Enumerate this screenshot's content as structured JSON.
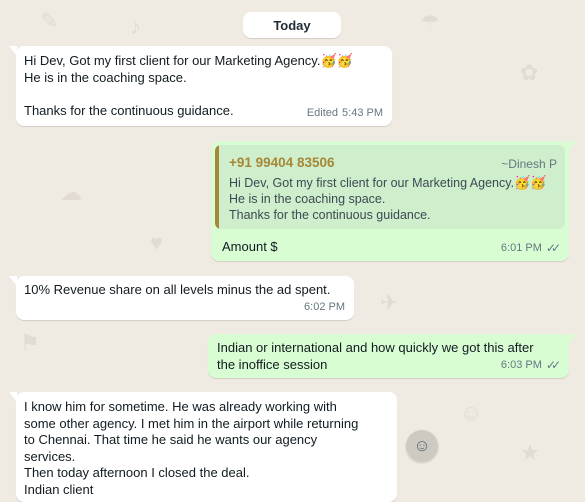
{
  "date_pill": "Today",
  "messages": [
    {
      "line1": "Hi Dev, Got my first client for our Marketing Agency.",
      "emoji": "🥳🥳",
      "rest": "He is in the coaching space.\n\nThanks for the continuous guidance.",
      "edited": "Edited",
      "time": "5:43 PM"
    },
    {
      "quote_sender": "+91 99404 83506",
      "quote_name": "~Dinesh P",
      "quote_line1": "Hi Dev, Got my first client for our Marketing Agency.",
      "quote_emoji": "🥳🥳",
      "quote_rest": "He is in the coaching space.\nThanks for the continuous guidance.",
      "text": "Amount $",
      "time": "6:01 PM"
    },
    {
      "text": "10% Revenue share on all levels minus the ad spent.",
      "time": "6:02 PM"
    },
    {
      "text": "Indian or international and how quickly we got this after\nthe inoffice session",
      "time": "6:03 PM"
    },
    {
      "text": "I know him for sometime. He was already working with\nsome other agency. I met him in the airport while returning\nto Chennai. That time he said he wants our agency\nservices.\nThen today afternoon I closed the deal.\nIndian client"
    }
  ],
  "icons": {
    "read_receipt": "double-check-icon",
    "emoji_button": "emoji-icon"
  }
}
